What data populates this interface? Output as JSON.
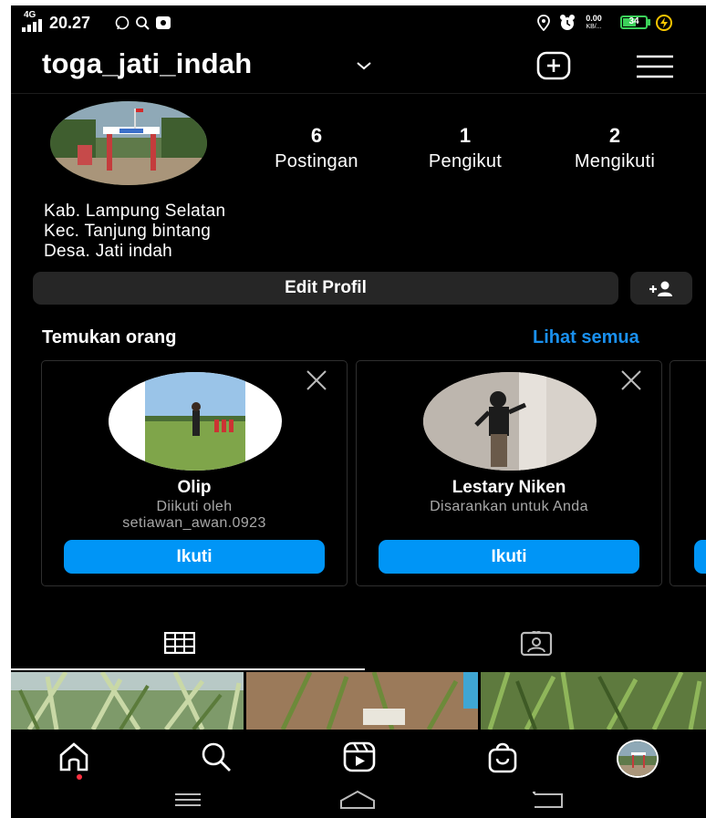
{
  "status_bar": {
    "network": "4G",
    "time": "20.27",
    "data_speed_top": "0.00",
    "data_speed_bottom": "KB/...",
    "battery": "34"
  },
  "header": {
    "username": "toga_jati_indah"
  },
  "profile": {
    "stats": [
      {
        "value": "6",
        "label": "Postingan"
      },
      {
        "value": "1",
        "label": "Pengikut"
      },
      {
        "value": "2",
        "label": "Mengikuti"
      }
    ],
    "bio": [
      "Kab. Lampung Selatan",
      "Kec. Tanjung bintang",
      "Desa. Jati indah"
    ],
    "edit_label": "Edit Profil"
  },
  "discover": {
    "title": "Temukan orang",
    "see_all": "Lihat semua",
    "cards": [
      {
        "name": "Olip",
        "subtitle_1": "Diikuti oleh",
        "subtitle_2": "setiawan_awan.0923",
        "follow_label": "Ikuti"
      },
      {
        "name": "Lestary Niken",
        "subtitle_1": "Disarankan untuk Anda",
        "follow_label": "Ikuti"
      }
    ]
  },
  "tabs": [
    "grid-icon",
    "tagged-icon"
  ],
  "bottom_nav": [
    "home-icon",
    "search-icon",
    "reels-icon",
    "shop-icon",
    "profile-avatar"
  ],
  "colors": {
    "background": "#000000",
    "accent": "#0095f6",
    "link": "#1a90ee",
    "button_dark": "#262626"
  }
}
